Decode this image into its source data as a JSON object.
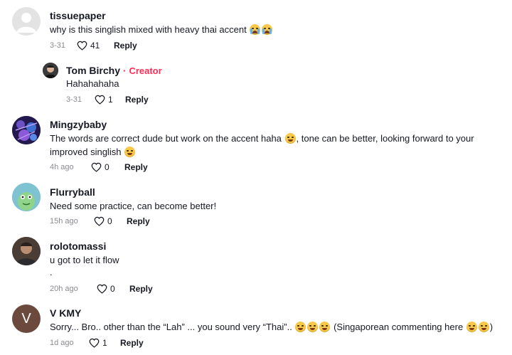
{
  "comments": [
    {
      "username": "tissuepaper",
      "text": "why is this singlish mixed with heavy thai accent",
      "emoji_after": [
        "crying-laughing-emoji",
        "crying-laughing-emoji"
      ],
      "time": "3-31",
      "likes": "41",
      "reply_label": "Reply",
      "avatar_icon": "default-avatar-icon",
      "reply": {
        "username": "Tom Birchy",
        "separator": "·",
        "badge": "Creator",
        "text": "Hahahahaha",
        "time": "3-31",
        "likes": "1",
        "reply_label": "Reply",
        "avatar_icon": "profile-photo-avatar"
      }
    },
    {
      "username": "Mingzybaby",
      "text_part1": "The words are correct dude but work on the accent haha",
      "text_part2": ", tone can be better, looking forward to your",
      "text_part3": "improved singlish",
      "time": "4h ago",
      "likes": "0",
      "reply_label": "Reply",
      "avatar_icon": "purple-pattern-avatar"
    },
    {
      "username": "Flurryball",
      "text": "Need some practice, can become better!",
      "time": "15h ago",
      "likes": "0",
      "reply_label": "Reply",
      "avatar_icon": "green-character-avatar"
    },
    {
      "username": "rolotomassi",
      "text": "u got to let it flow",
      "text_line2": ".",
      "time": "20h ago",
      "likes": "0",
      "reply_label": "Reply",
      "avatar_icon": "profile-photo-avatar"
    },
    {
      "username": "V KMY",
      "avatar_letter": "V",
      "text_part1": "Sorry... Bro.. other than the “Lah” ... you sound very “Thai”..",
      "text_part2": "(Singaporean commenting here",
      "text_part3": ")",
      "time": "1d ago",
      "likes": "1",
      "reply_label": "Reply",
      "avatar_icon": "letter-avatar"
    }
  ],
  "colors": {
    "accent": "#fe2c55",
    "meta_gray": "#8a8b91",
    "text": "#161823"
  }
}
